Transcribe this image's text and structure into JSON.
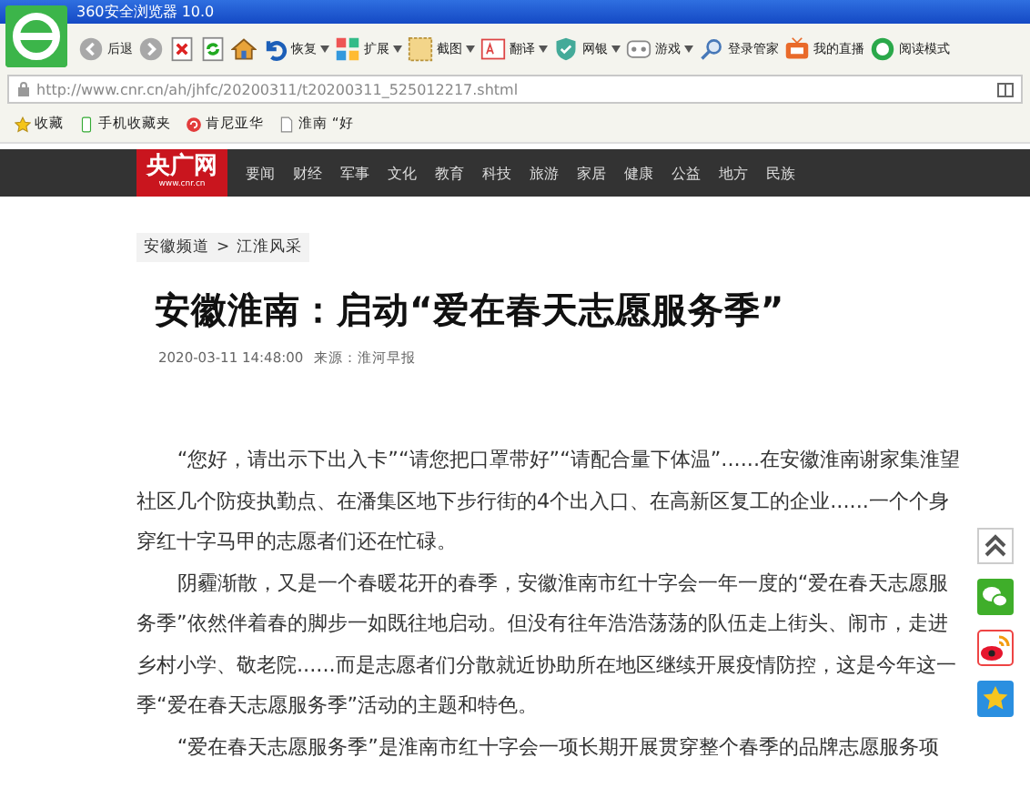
{
  "window": {
    "title": "360安全浏览器 10.0"
  },
  "toolbar": [
    {
      "kind": "back",
      "label": "后退",
      "dropdown": false
    },
    {
      "kind": "forward",
      "dropdown": false
    },
    {
      "kind": "stop",
      "dropdown": false
    },
    {
      "kind": "refresh",
      "dropdown": false
    },
    {
      "kind": "home",
      "dropdown": false
    },
    {
      "kind": "restore",
      "label": "恢复",
      "dropdown": true
    },
    {
      "kind": "extensions",
      "label": "扩展",
      "dropdown": true
    },
    {
      "kind": "screenshot",
      "label": "截图",
      "dropdown": true
    },
    {
      "kind": "translate",
      "label": "翻译",
      "dropdown": true
    },
    {
      "kind": "bank",
      "label": "网银",
      "dropdown": true
    },
    {
      "kind": "games",
      "label": "游戏",
      "dropdown": true
    },
    {
      "kind": "login",
      "label": "登录管家",
      "dropdown": false
    },
    {
      "kind": "live",
      "label": "我的直播",
      "dropdown": false
    },
    {
      "kind": "reader",
      "label": "阅读模式",
      "dropdown": false
    }
  ],
  "address_bar": {
    "url": "http://www.cnr.cn/ah/jhfc/20200311/t20200311_525012217.shtml"
  },
  "favorites": [
    {
      "kind": "star",
      "label": "收藏"
    },
    {
      "kind": "phone",
      "label": "手机收藏夹"
    },
    {
      "kind": "site",
      "label": "肯尼亚华"
    },
    {
      "kind": "page",
      "label": "淮南 “好"
    }
  ],
  "site_nav": {
    "logo": "央广网",
    "logo_domain": "www.cnr.cn",
    "items": [
      "要闻",
      "财经",
      "军事",
      "文化",
      "教育",
      "科技",
      "旅游",
      "家居",
      "健康",
      "公益",
      "地方",
      "民族"
    ]
  },
  "article": {
    "breadcrumb": [
      "安徽频道",
      ">",
      "江淮风采"
    ],
    "title": "安徽淮南：启动“爱在春天志愿服务季”",
    "date": "2020-03-11 14:48:00",
    "source": "来源：淮河早报",
    "paragraphs": [
      "“您好，请出示下出入卡”“请您把口罩带好”“请配合量下体温”......在安徽淮南谢家集淮望社区几个防疫执勤点、在潘集区地下步行街的4个出入口、在高新区复工的企业......一个个身穿红十字马甲的志愿者们还在忙碌。",
      "阴霾渐散，又是一个春暖花开的春季，安徽淮南市红十字会一年一度的“爱在春天志愿服务季”依然伴着春的脚步一如既往地启动。但没有往年浩浩荡荡的队伍走上街头、闹市，走进乡村小学、敬老院......而是志愿者们分散就近协助所在地区继续开展疫情防控，这是今年这一季“爱在春天志愿服务季”活动的主题和特色。",
      "“爱在春天志愿服务季”是淮南市红十字会一项长期开展贯穿整个春季的品牌志愿服务项"
    ]
  },
  "side_buttons": [
    {
      "kind": "top"
    },
    {
      "kind": "wechat"
    },
    {
      "kind": "weibo"
    },
    {
      "kind": "qzone"
    }
  ]
}
